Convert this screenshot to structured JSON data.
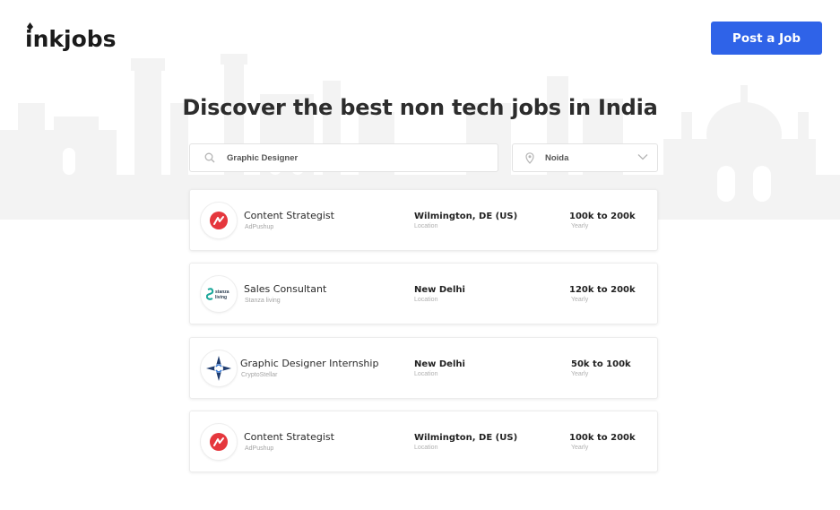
{
  "brand": {
    "name": "inkjobs",
    "icon": "pen-nib-icon"
  },
  "header": {
    "post_job_label": "Post a Job",
    "accent_color": "#2f63e8"
  },
  "hero": {
    "headline": "Discover the best non tech jobs in India"
  },
  "search": {
    "query_value": "Graphic Designer",
    "location_value": "Noida",
    "search_icon": "search-icon",
    "location_icon": "map-pin-icon",
    "dropdown_icon": "chevron-down-icon"
  },
  "jobs": [
    {
      "title": "Content Strategist",
      "company": "AdPushup",
      "location": "Wilmington, DE (US)",
      "location_label": "Location",
      "salary": "100k to 200k",
      "salary_label": "Yearly",
      "logo": "adpushup-logo"
    },
    {
      "title": "Sales Consultant",
      "company": "Stanza living",
      "location": "New Delhi",
      "location_label": "Location",
      "salary": "120k to 200k",
      "salary_label": "Yearly",
      "logo": "stanza-living-logo",
      "logo_text": "stanza living"
    },
    {
      "title": "Graphic Designer Internship",
      "company": "CryptoStellar",
      "location": "New Delhi",
      "location_label": "Location",
      "salary": "50k to 100k",
      "salary_label": "Yearly",
      "logo": "cryptostellar-logo"
    },
    {
      "title": "Content Strategist",
      "company": "AdPushup",
      "location": "Wilmington, DE (US)",
      "location_label": "Location",
      "salary": "100k to 200k",
      "salary_label": "Yearly",
      "logo": "adpushup-logo"
    }
  ]
}
